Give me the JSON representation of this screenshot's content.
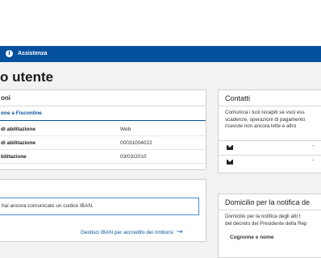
{
  "navbar": {
    "assist_label": "Assistenza",
    "assist_icon": "info-icon"
  },
  "page": {
    "title": "o utente"
  },
  "abilitazioni": {
    "header": "oni",
    "fisco_label": "one a Fisconline",
    "rows": [
      {
        "label": "di abilitazione",
        "value": "Web"
      },
      {
        "label": "di abilitazione",
        "value": "00031004022"
      },
      {
        "label": "bilitazione",
        "value": "03/03/2010"
      }
    ]
  },
  "iban": {
    "message": "hai ancora comunicato un codice IBAN.",
    "link_label": "Gestisci IBAN per accredito dei rimborsi",
    "link_icon": "arrow-right-icon"
  },
  "contatti": {
    "header": "Contatti",
    "text_lines": [
      "Comunica i tuoi recapiti se vuoi ess",
      "scadenze, operazioni di pagamento",
      "ricevute non ancora lette e altro"
    ],
    "rows": [
      {
        "icon": "envelope-icon",
        "value": "-"
      },
      {
        "icon": "envelope-icon",
        "value": "-"
      }
    ]
  },
  "domicilio": {
    "header": "Domicilio per la notifica de",
    "text_lines": [
      "Domicilio per la notifica degli atti t",
      "del decreto del Presidente della Rep"
    ],
    "field_label": "Cognome e nome"
  },
  "colors": {
    "navbar": "#06519e",
    "link": "#06519e",
    "background": "#f2f2f2"
  }
}
